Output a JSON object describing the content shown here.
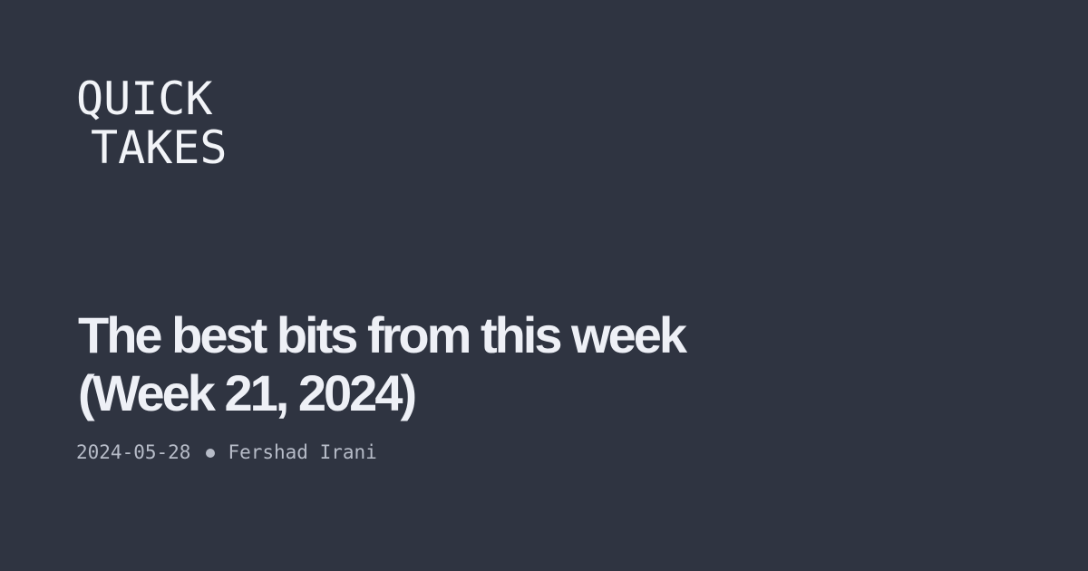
{
  "brand": {
    "line1": "QUICK",
    "line2": "TAKES"
  },
  "post": {
    "title_line1": "The best bits from this week",
    "title_line2": "(Week 21, 2024)",
    "date": "2024-05-28",
    "author": "Fershad Irani"
  },
  "colors": {
    "background": "#2f3441",
    "title": "#eef0f6",
    "meta": "#b7bcc8"
  }
}
